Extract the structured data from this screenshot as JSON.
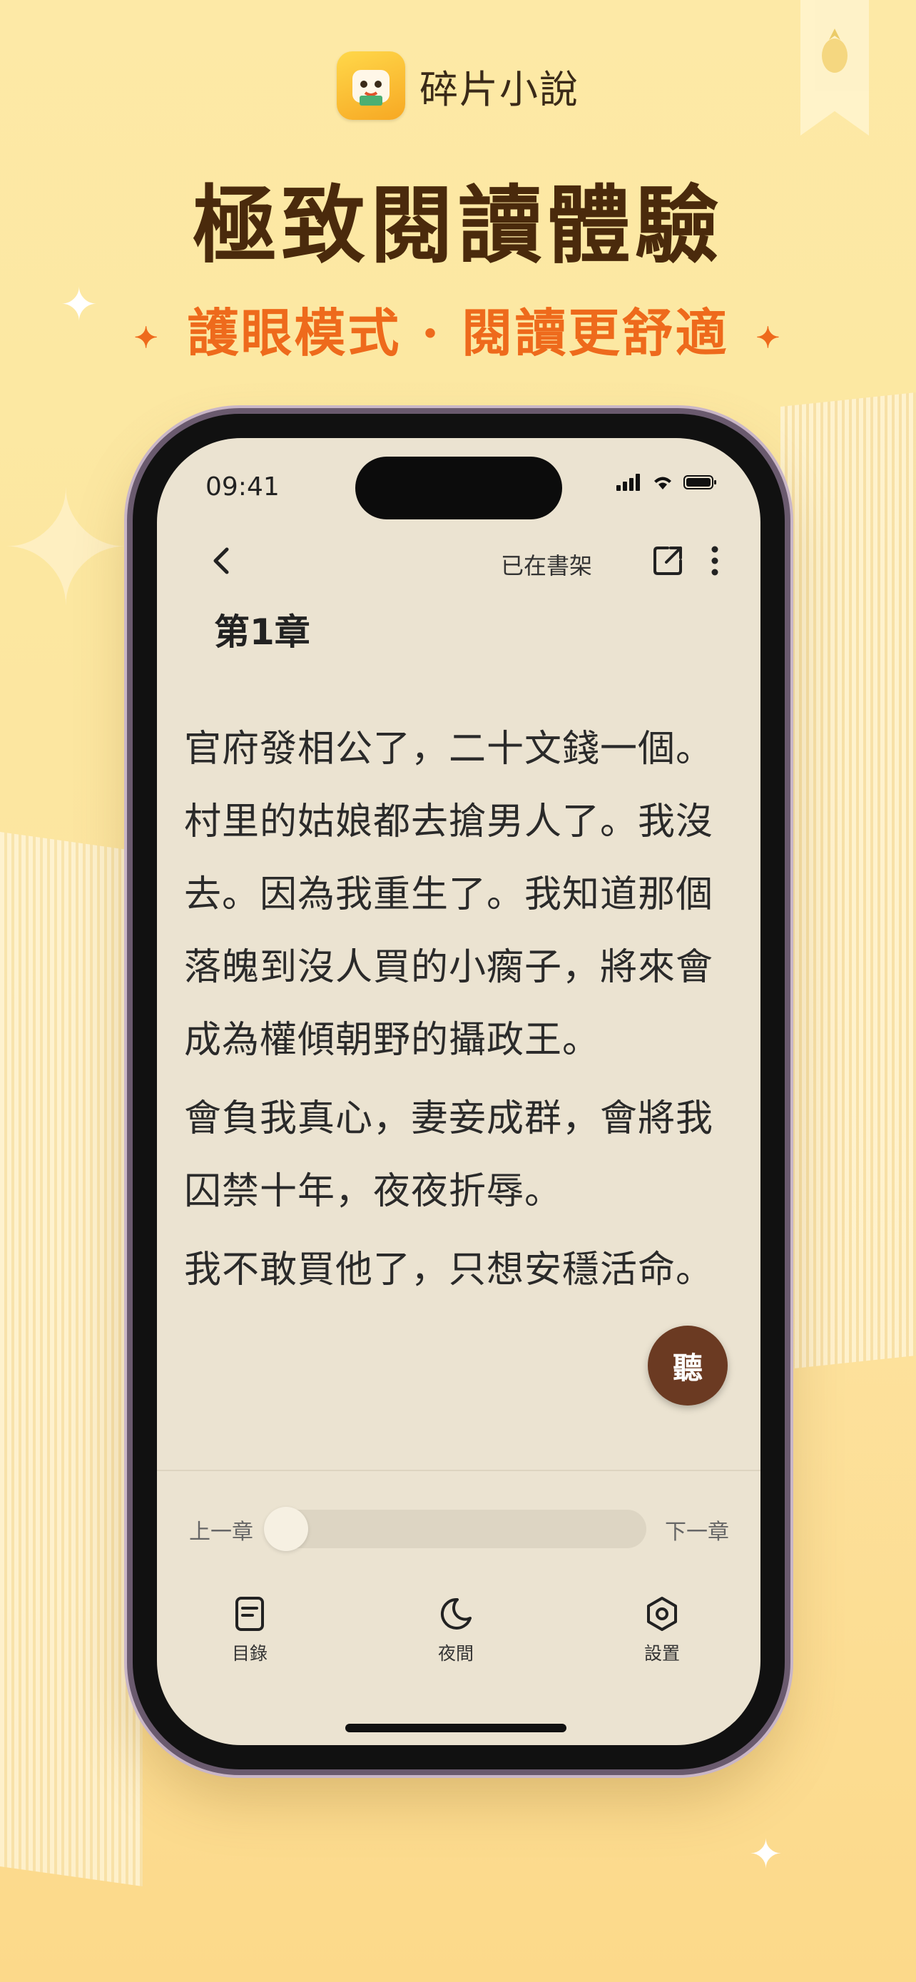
{
  "promo": {
    "app_name": "碎片小說",
    "headline": "極致閱讀體驗",
    "subline": "護眼模式 · 閱讀更舒適",
    "star": "✦"
  },
  "status_bar": {
    "time": "09:41"
  },
  "reader": {
    "top_bar": {
      "shelf_status": "已在書架"
    },
    "chapter_title": "第1章",
    "paragraphs": [
      "官府發相公了，二十文錢一個。村里的姑娘都去搶男人了。我沒去。因為我重生了。我知道那個落魄到沒人買的小瘸子，將來會成為權傾朝野的攝政王。",
      "會負我真心，妻妾成群，會將我囚禁十年，夜夜折辱。",
      "我不敢買他了，只想安穩活命。"
    ],
    "listen_label": "聽",
    "chapter_nav": {
      "prev": "上一章",
      "next": "下一章",
      "progress_fraction": 0.0
    },
    "bottom_nav": [
      {
        "label": "目錄",
        "icon": "catalog-icon"
      },
      {
        "label": "夜間",
        "icon": "moon-icon"
      },
      {
        "label": "設置",
        "icon": "settings-icon"
      }
    ]
  },
  "colors": {
    "background": "#fde9a6",
    "headline": "#4a2a0c",
    "accent_orange": "#ee6a1c",
    "reader_bg": "#ebe3d1",
    "listen_button": "#6b3a22"
  }
}
